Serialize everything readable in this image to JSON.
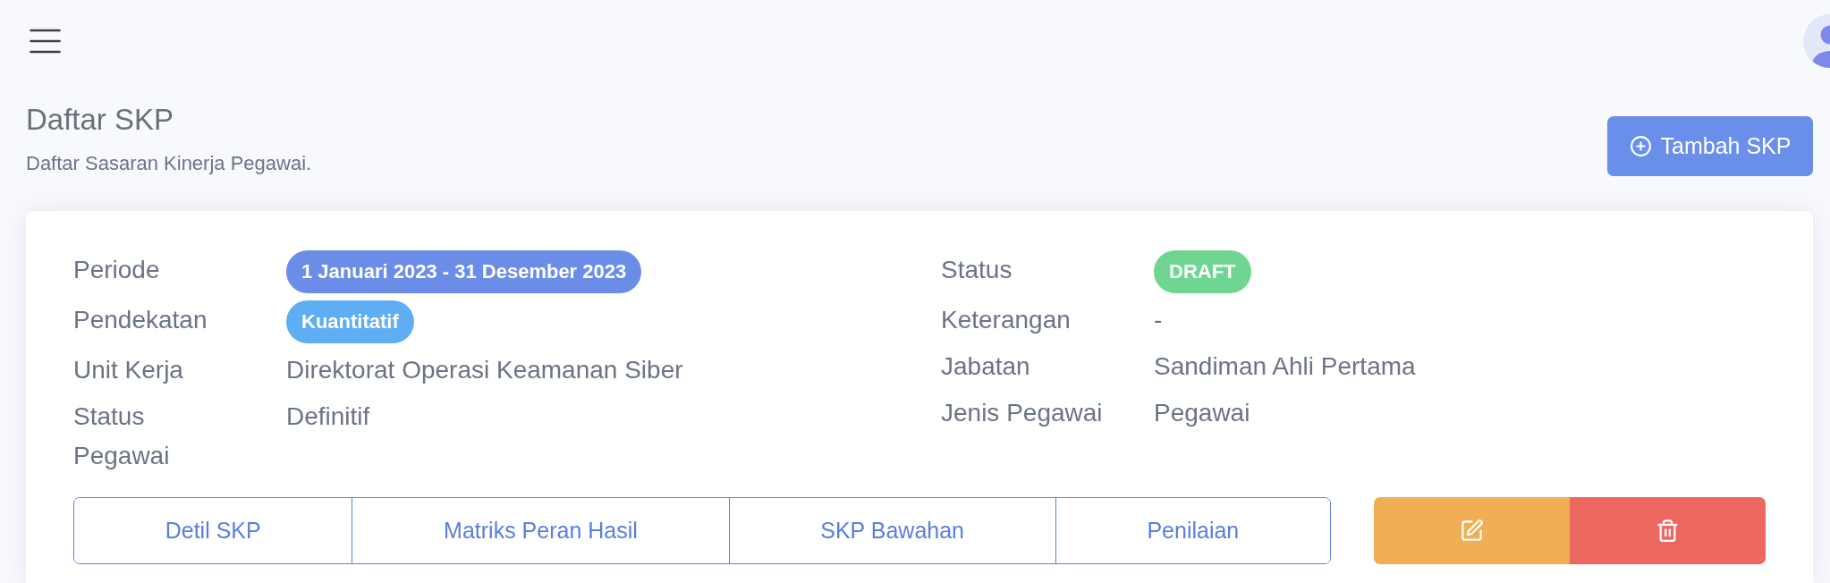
{
  "page_header": {
    "title": "Daftar SKP",
    "subtitle": "Daftar Sasaran Kinerja Pegawai.",
    "add_button": {
      "label": "Tambah SKP"
    }
  },
  "skp_card": {
    "left_fields": [
      {
        "label": "Periode",
        "value": "1 Januari 2023 - 31 Desember 2023",
        "kind": "badge",
        "color": "#6b8de8"
      },
      {
        "label": "Pendekatan",
        "value": "Kuantitatif",
        "kind": "badge",
        "color": "#5fadf2"
      },
      {
        "label": "Unit Kerja",
        "value": "Direktorat Operasi Keamanan Siber",
        "kind": "text"
      },
      {
        "label": "Status Pegawai",
        "value": "Definitif",
        "kind": "text"
      }
    ],
    "right_fields": [
      {
        "label": "Status",
        "value": "DRAFT",
        "kind": "badge",
        "color": "#6fd692"
      },
      {
        "label": "Keterangan",
        "value": "-",
        "kind": "text"
      },
      {
        "label": "Jabatan",
        "value": "Sandiman Ahli Pertama",
        "kind": "text"
      },
      {
        "label": "Jenis Pegawai",
        "value": "Pegawai",
        "kind": "text"
      }
    ],
    "section_buttons": [
      {
        "label": "Detil SKP"
      },
      {
        "label": "Matriks Peran Hasil"
      },
      {
        "label": "SKP Bawahan"
      },
      {
        "label": "Penilaian"
      }
    ],
    "actions": [
      {
        "kind": "edit"
      },
      {
        "kind": "delete"
      }
    ]
  }
}
